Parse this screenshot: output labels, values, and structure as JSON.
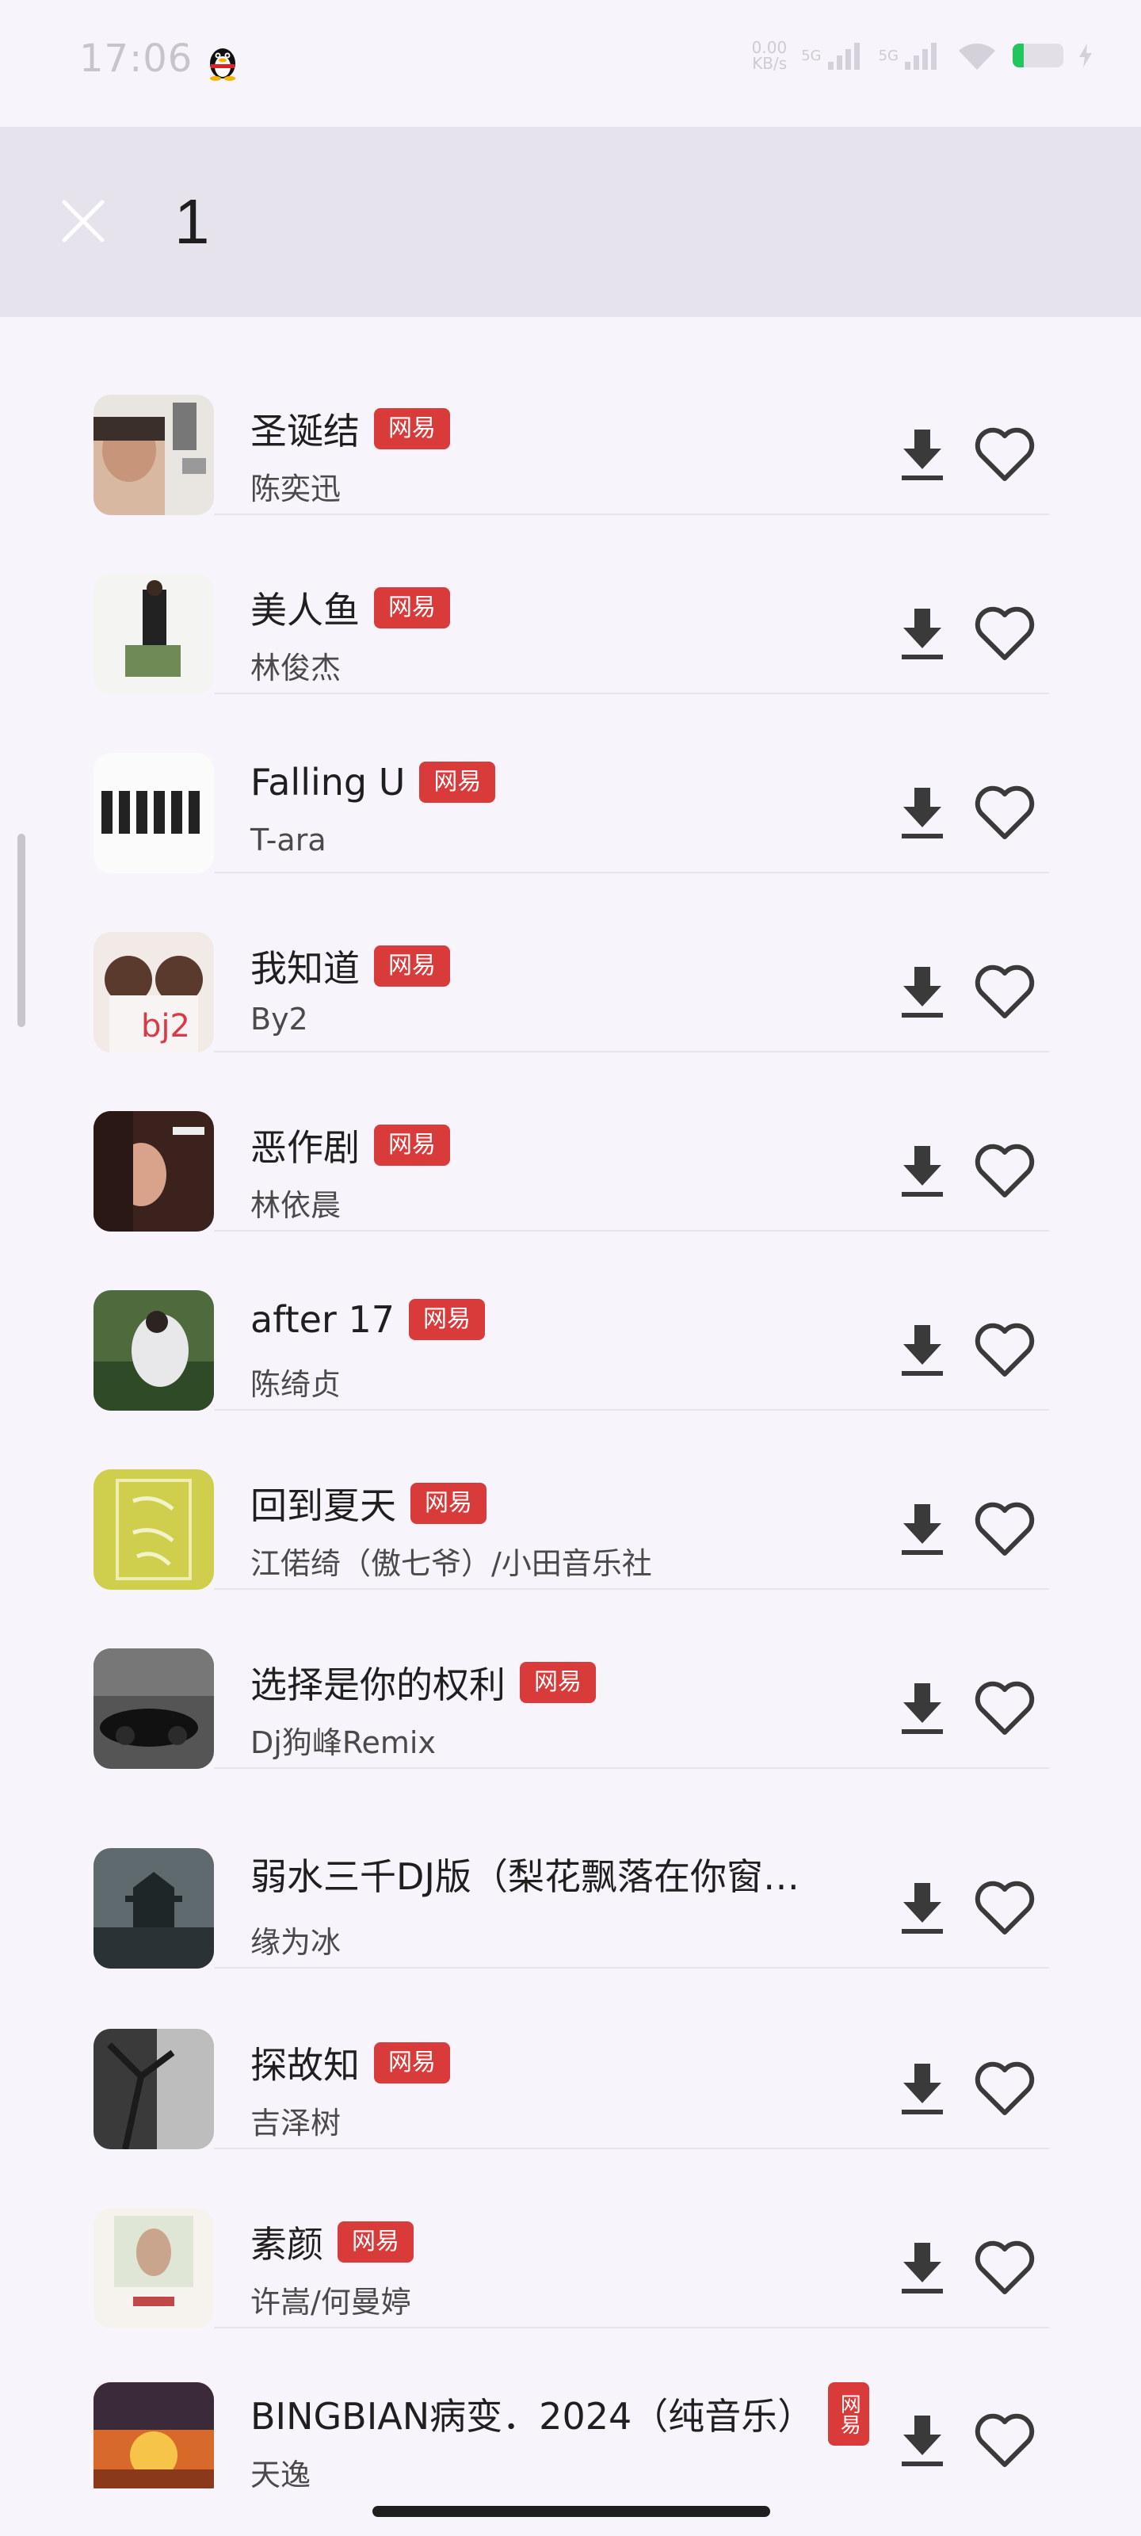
{
  "status_bar": {
    "time": "17:06",
    "network_speed": "0.00 KB/s",
    "signal_1": "5G",
    "signal_2": "5G",
    "app_icon": "qq-penguin-icon",
    "battery_color": "#22c55e"
  },
  "search": {
    "query": "1",
    "close_icon": "close-icon"
  },
  "badge_color": "#d93b3b",
  "songs": [
    {
      "title": "圣诞结",
      "artist": "陈奕迅",
      "badge": "网易"
    },
    {
      "title": "美人鱼",
      "artist": "林俊杰",
      "badge": "网易"
    },
    {
      "title": "Falling U",
      "artist": "T-ara",
      "badge": "网易"
    },
    {
      "title": "我知道",
      "artist": "By2",
      "badge": "网易"
    },
    {
      "title": "恶作剧",
      "artist": "林依晨",
      "badge": "网易"
    },
    {
      "title": "after 17",
      "artist": "陈绮贞",
      "badge": "网易"
    },
    {
      "title": "回到夏天",
      "artist": "江偌绮（傲七爷）/小田音乐社",
      "badge": "网易"
    },
    {
      "title": "选择是你的权利",
      "artist": "Dj狗峰Remix",
      "badge": "网易"
    },
    {
      "title": "弱水三千DJ版（梨花飘落在你窗…",
      "artist": "缘为冰",
      "badge": ""
    },
    {
      "title": "探故知",
      "artist": "吉泽树",
      "badge": "网易"
    },
    {
      "title": "素颜",
      "artist": "许嵩/何曼婷",
      "badge": "网易"
    },
    {
      "title": "BINGBIAN病变．2024（纯音乐）",
      "artist": "天逸",
      "badge": "网易"
    }
  ]
}
